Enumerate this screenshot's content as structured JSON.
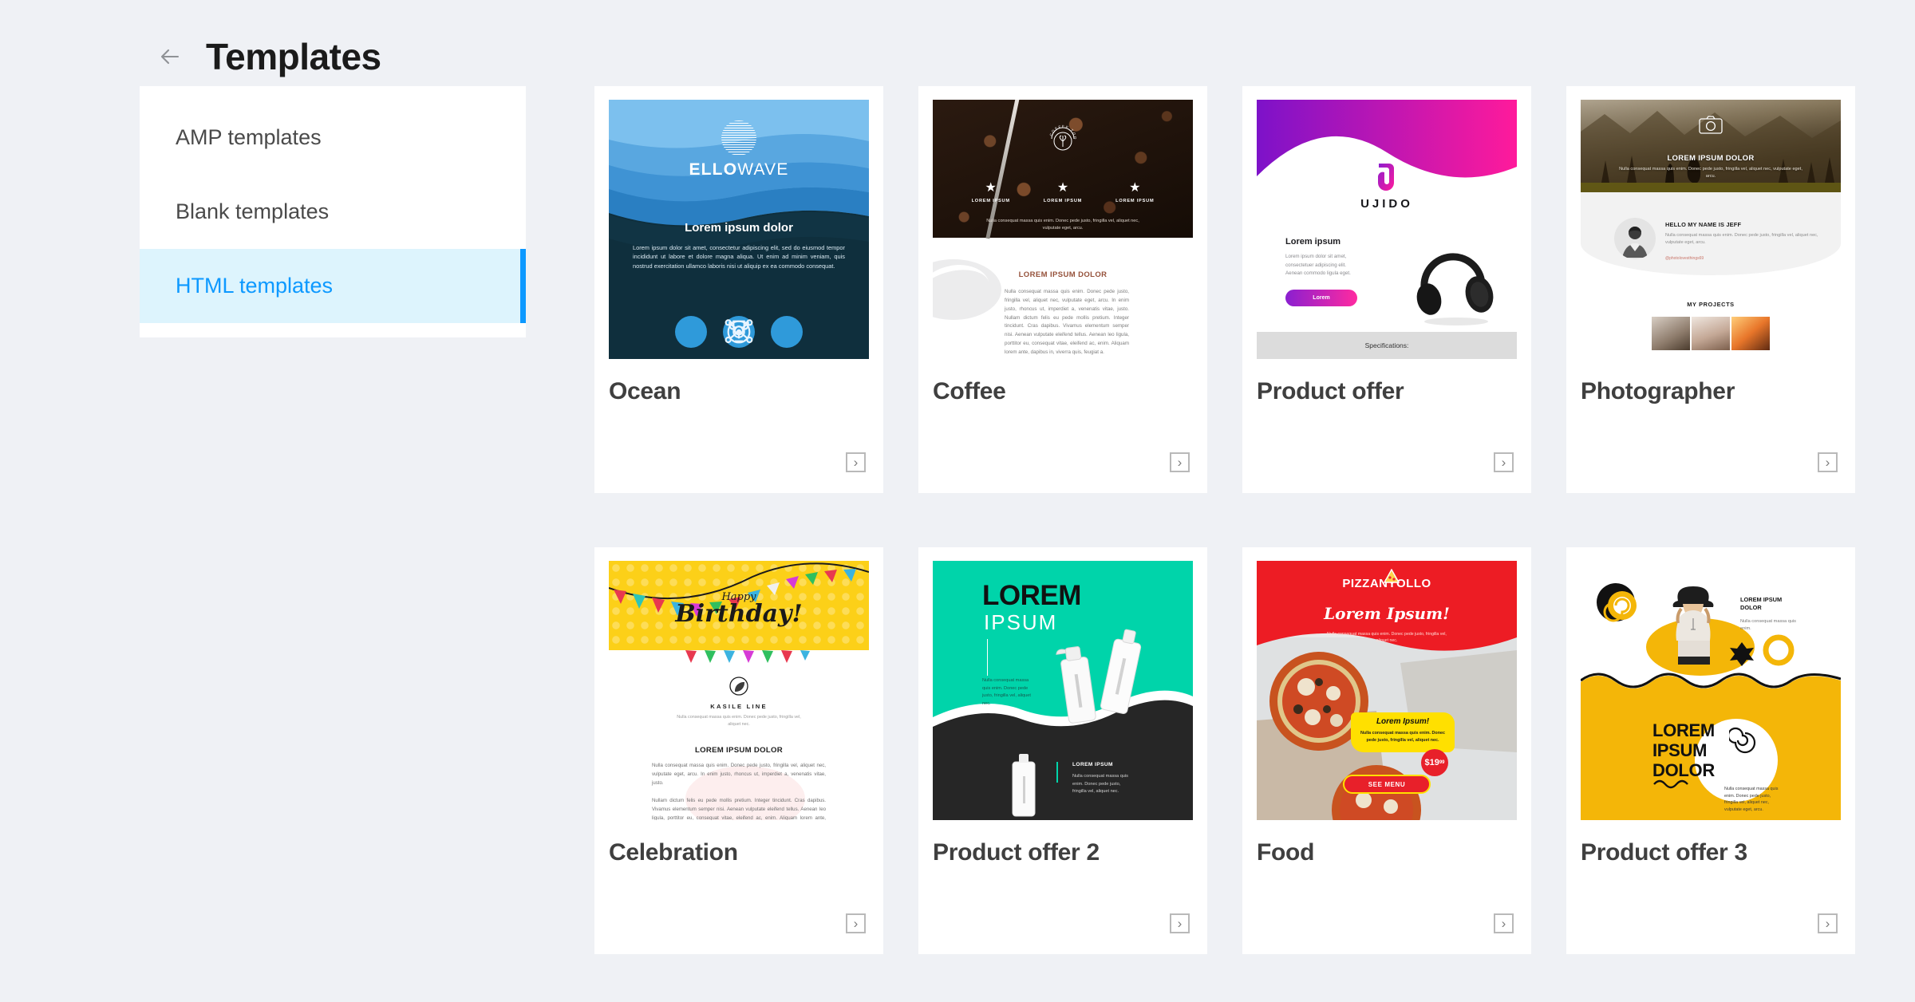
{
  "header": {
    "title": "Templates",
    "back_icon": "arrow-left-icon"
  },
  "sidebar": {
    "items": [
      {
        "label": "AMP templates",
        "active": false
      },
      {
        "label": "Blank templates",
        "active": false
      },
      {
        "label": "HTML templates",
        "active": true
      }
    ]
  },
  "colors": {
    "page_background": "#eff1f5",
    "panel": "#ffffff",
    "accent_blue": "#0d99ff",
    "accent_blue_bg": "#ddf4fd",
    "title_text": "#3f3f3f",
    "heading_text": "#1b1b1b"
  },
  "cards": {
    "open_button_icon": "chevron-right-icon",
    "rows": [
      [
        {
          "title": "Ocean",
          "preview": {
            "brand": "ELLOWAVE",
            "brand_bold": "ELLO",
            "brand_light": "WAVE",
            "heading": "Lorem ipsum dolor",
            "body": "Lorem ipsum dolor sit amet, consectetur adipiscing elit, sed do eiusmod tempor incididunt ut labore et dolore magna aliqua. Ut enim ad minim veniam, quis nostrud exercitation ullamco laboris nisi ut aliquip ex ea commodo consequat.",
            "icons": [
              "trophy-icon",
              "network-icon",
              "target-icon"
            ]
          }
        },
        {
          "title": "Coffee",
          "preview": {
            "badge_text": "COFFEE TOO",
            "features": [
              "LOREM IPSUM",
              "LOREM IPSUM",
              "LOREM IPSUM"
            ],
            "caption": "Nulla consequat massa quis enim. Donec pede justo, fringilla vel, aliquet nec, vulputate eget, arcu.",
            "heading": "LOREM IPSUM DOLOR",
            "body": "Nulla consequat massa quis enim. Donec pede justo, fringilla vel, aliquet nec, vulputate eget, arcu. In enim justo, rhoncus ut, imperdiet a, venenatis vitae, justo. Nullam dictum felis eu pede mollis pretium. Integer tincidunt. Cras dapibus. Vivamus elementum semper nisi. Aenean vulputate eleifend tellus. Aenean leo ligula, porttitor eu, consequat vitae, eleifend ac, enim. Aliquam lorem ante, dapibus in, viverra quis, feugiat a."
          }
        },
        {
          "title": "Product offer",
          "preview": {
            "brand": "UJIDO",
            "heading": "Lorem ipsum",
            "body": "Lorem ipsum dolor sit amet, consectetuer adipiscing elit. Aenean commodo ligula eget.",
            "button": "Lorem",
            "spec_label": "Specifications:"
          }
        },
        {
          "title": "Photographer",
          "preview": {
            "hero_heading": "LOREM IPSUM DOLOR",
            "hero_body": "Nulla consequat massa quis enim. Donec pede justo, fringilla vel, aliquet nec, vulputate eget, arcu.",
            "profile_heading": "HELLO MY NAME IS JEFF",
            "profile_body": "Nulla consequat massa quis enim. Donec pede justo, fringilla vel, aliquet nec, vulputate eget, arcu.",
            "profile_tag": "@photolovesthings69",
            "projects_heading": "MY PROJECTS"
          }
        }
      ],
      [
        {
          "title": "Celebration",
          "preview": {
            "banner_small": "Happy",
            "banner_big": "Birthday!",
            "brand": "KASILE LINE",
            "sub": "Nulla consequat massa quis enim. Donec pede justo, fringilla vel, aliquet nec.",
            "heading": "LOREM IPSUM DOLOR",
            "body": "Nulla consequat massa quis enim. Donec pede justo, fringilla vel, aliquet nec, vulputate eget, arcu. In enim justo, rhoncus ut, imperdiet a, venenatis vitae, justo.",
            "body2": "Nullam dictum felis eu pede mollis pretium. Integer tincidunt. Cras dapibus. Vivamus elementum semper nisi. Aenean vulputate eleifend tellus. Aenean leo ligula, porttitor eu, consequat vitae, eleifend ac, enim. Aliquam lorem ante, dapibus in, viverra quis, feugiat a."
          }
        },
        {
          "title": "Product offer 2",
          "preview": {
            "title_bold": "LOREM",
            "title_light": "IPSUM",
            "body": "Nulla consequat massa quis enim. Donec pede justo, fringilla vel, aliquet nec.",
            "bottom_heading": "LOREM IPSUM",
            "bottom_body": "Nulla consequat massa quis enim. Donec pede justo, fringilla vel, aliquet nec."
          }
        },
        {
          "title": "Food",
          "preview": {
            "brand": "PIZZANYOLLO",
            "script": "Lorem Ipsum!",
            "sub": "Nulla consequat massa quis enim. Donec pede justo, fringilla vel, aliquet nec.",
            "highlight_heading": "Lorem Ipsum!",
            "highlight_body": "Nulla consequat massa quis enim. Donec pede justo, fringilla vel, aliquet nec.",
            "price": "$19",
            "price_cents": "99",
            "button": "SEE MENU"
          }
        },
        {
          "title": "Product offer 3",
          "preview": {
            "heading": "LOREM IPSUM DOLOR",
            "body": "Nulla consequat massa quis enim.",
            "big_heading": "LOREM IPSUM DOLOR",
            "bottom_body": "Nulla consequat massa quis enim. Donec pede justo, fringilla vel, aliquet nec, vulputate eget, arcu."
          }
        }
      ]
    ]
  }
}
